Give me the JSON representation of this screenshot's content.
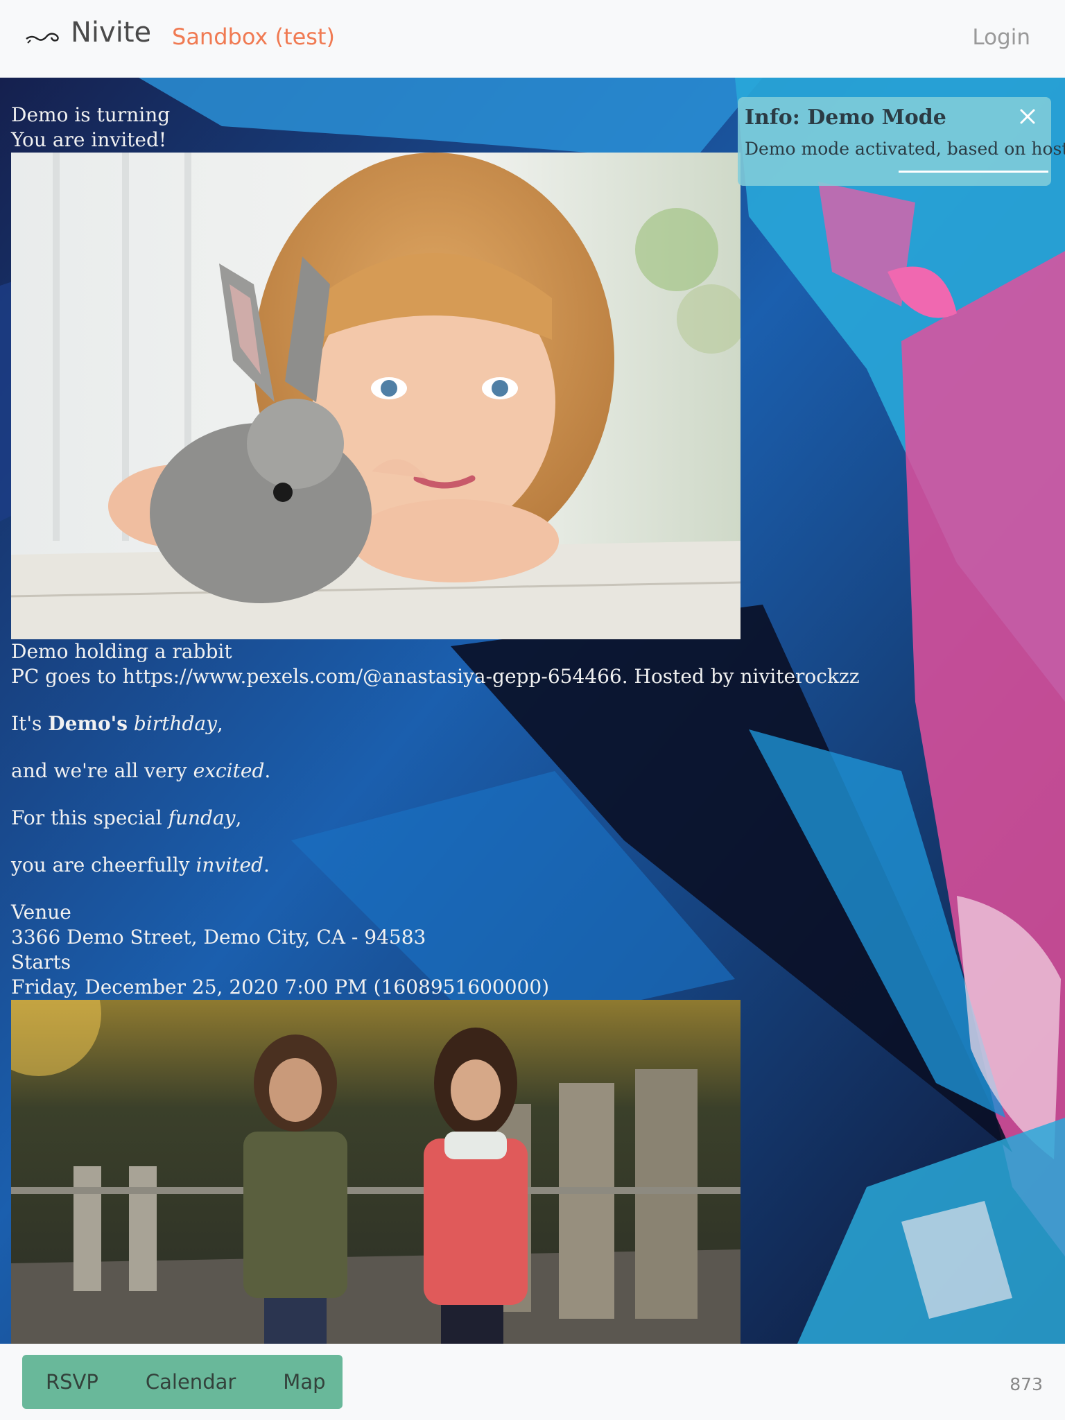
{
  "header": {
    "brand": "Nivite",
    "environment": "Sandbox (test)",
    "login_label": "Login",
    "logo_icon": "scroll-swirl-icon"
  },
  "toast": {
    "title": "Info: Demo Mode",
    "message": "Demo mode activated, based on hostname",
    "close_icon": "close-icon",
    "progress": 0.47
  },
  "invite": {
    "heading_line1": "Demo is turning",
    "heading_line2": "You are invited!",
    "photo1_caption": "Demo holding a rabbit",
    "photo1_credit": "PC goes to https://www.pexels.com/@anastasiya-gepp-654466. Hosted by niviterockzz",
    "poem": [
      {
        "pre": "It's ",
        "bold": "Demo's",
        "mid": " ",
        "italic": "birthday",
        "post": ","
      },
      {
        "pre": "and we're all very ",
        "italic": "excited",
        "post": "."
      },
      {
        "pre": "For this special ",
        "italic": "funday",
        "post": ","
      },
      {
        "pre": "you are cheerfully ",
        "italic": "invited",
        "post": "."
      }
    ],
    "venue_label": "Venue",
    "venue_address": "3366 Demo Street, Demo City, CA - 94583",
    "starts_label": "Starts",
    "starts_value": "Friday, December 25, 2020 7:00 PM (1608951600000)"
  },
  "footer": {
    "buttons": [
      "RSVP",
      "Calendar",
      "Map"
    ],
    "counter": "873"
  },
  "colors": {
    "accent_orange": "#f07a52",
    "button_green": "#69b89a",
    "toast_bg": "#82cdda"
  }
}
